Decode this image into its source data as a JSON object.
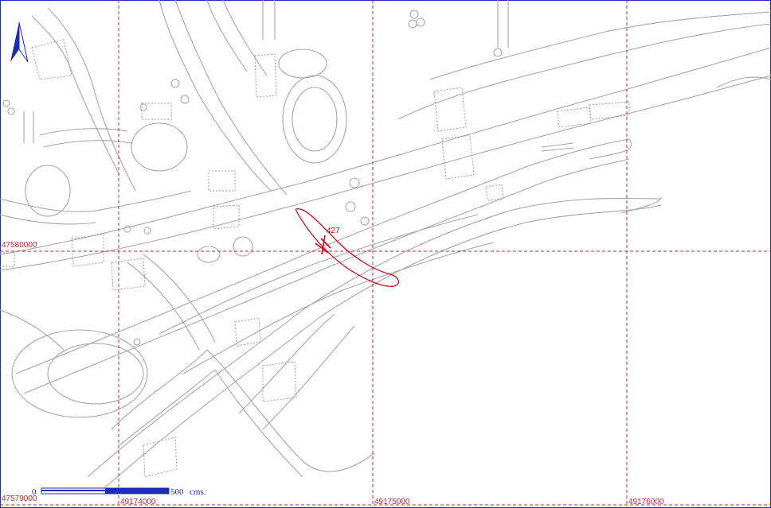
{
  "grid": {
    "vertical_lines": [
      {
        "label": "49174000"
      },
      {
        "label": "49175000"
      },
      {
        "label": "49176000"
      }
    ],
    "horizontal_lines": [
      {
        "label": "47580000"
      },
      {
        "label": "47579000"
      }
    ]
  },
  "feature": {
    "label": "427",
    "color": "#e0001a"
  },
  "scale_bar": {
    "start_label": "0",
    "end_label": "500",
    "unit": "cms."
  },
  "north_arrow": {
    "label": "N"
  },
  "colors": {
    "grid": "#c0282d",
    "lines": "#a6a6a6",
    "frame": "#1f2db5",
    "scale": "#1f2db5"
  }
}
